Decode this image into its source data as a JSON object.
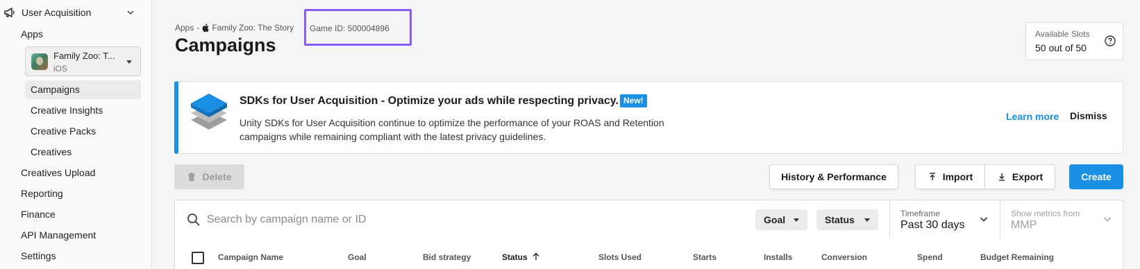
{
  "sidebar": {
    "section_label": "User Acquisition",
    "apps_label": "Apps",
    "app_select": {
      "name": "Family Zoo: T...",
      "platform": "iOS"
    },
    "sub_items": [
      {
        "label": "Campaigns"
      },
      {
        "label": "Creative Insights"
      },
      {
        "label": "Creative Packs"
      },
      {
        "label": "Creatives"
      }
    ],
    "items": [
      {
        "label": "Creatives Upload"
      },
      {
        "label": "Reporting"
      },
      {
        "label": "Finance"
      },
      {
        "label": "API Management"
      },
      {
        "label": "Settings"
      }
    ]
  },
  "header": {
    "breadcrumb": {
      "apps": "Apps",
      "sep": "-",
      "app": "Family Zoo: The Story",
      "game_id": "Game ID: 500004896"
    },
    "title": "Campaigns",
    "slots": {
      "label": "Available Slots",
      "value": "50 out of 50"
    }
  },
  "banner": {
    "title": "SDKs for User Acquisition - Optimize your ads while respecting privacy.",
    "badge": "New!",
    "text": "Unity SDKs for User Acquisition continue to optimize the performance of your ROAS and Retention campaigns while remaining compliant with the latest privacy guidelines.",
    "learn_more": "Learn more",
    "dismiss": "Dismiss",
    "accent": "#1a8fe3"
  },
  "toolbar": {
    "delete": "Delete",
    "history": "History & Performance",
    "import": "Import",
    "export": "Export",
    "create": "Create"
  },
  "filters": {
    "search_placeholder": "Search by campaign name or ID",
    "goal": "Goal",
    "status": "Status",
    "timeframe": {
      "label": "Timeframe",
      "value": "Past 30 days"
    },
    "metrics": {
      "label": "Show metrics from",
      "value": "MMP"
    }
  },
  "table": {
    "columns": [
      "Campaign Name",
      "Goal",
      "Bid strategy",
      "Status",
      "Slots Used",
      "Starts",
      "Installs",
      "Conversion",
      "Spend",
      "Budget Remaining"
    ],
    "sorted_column": "Status"
  },
  "colors": {
    "primary": "#1a8fe3",
    "highlight": "#8a5cf6"
  }
}
